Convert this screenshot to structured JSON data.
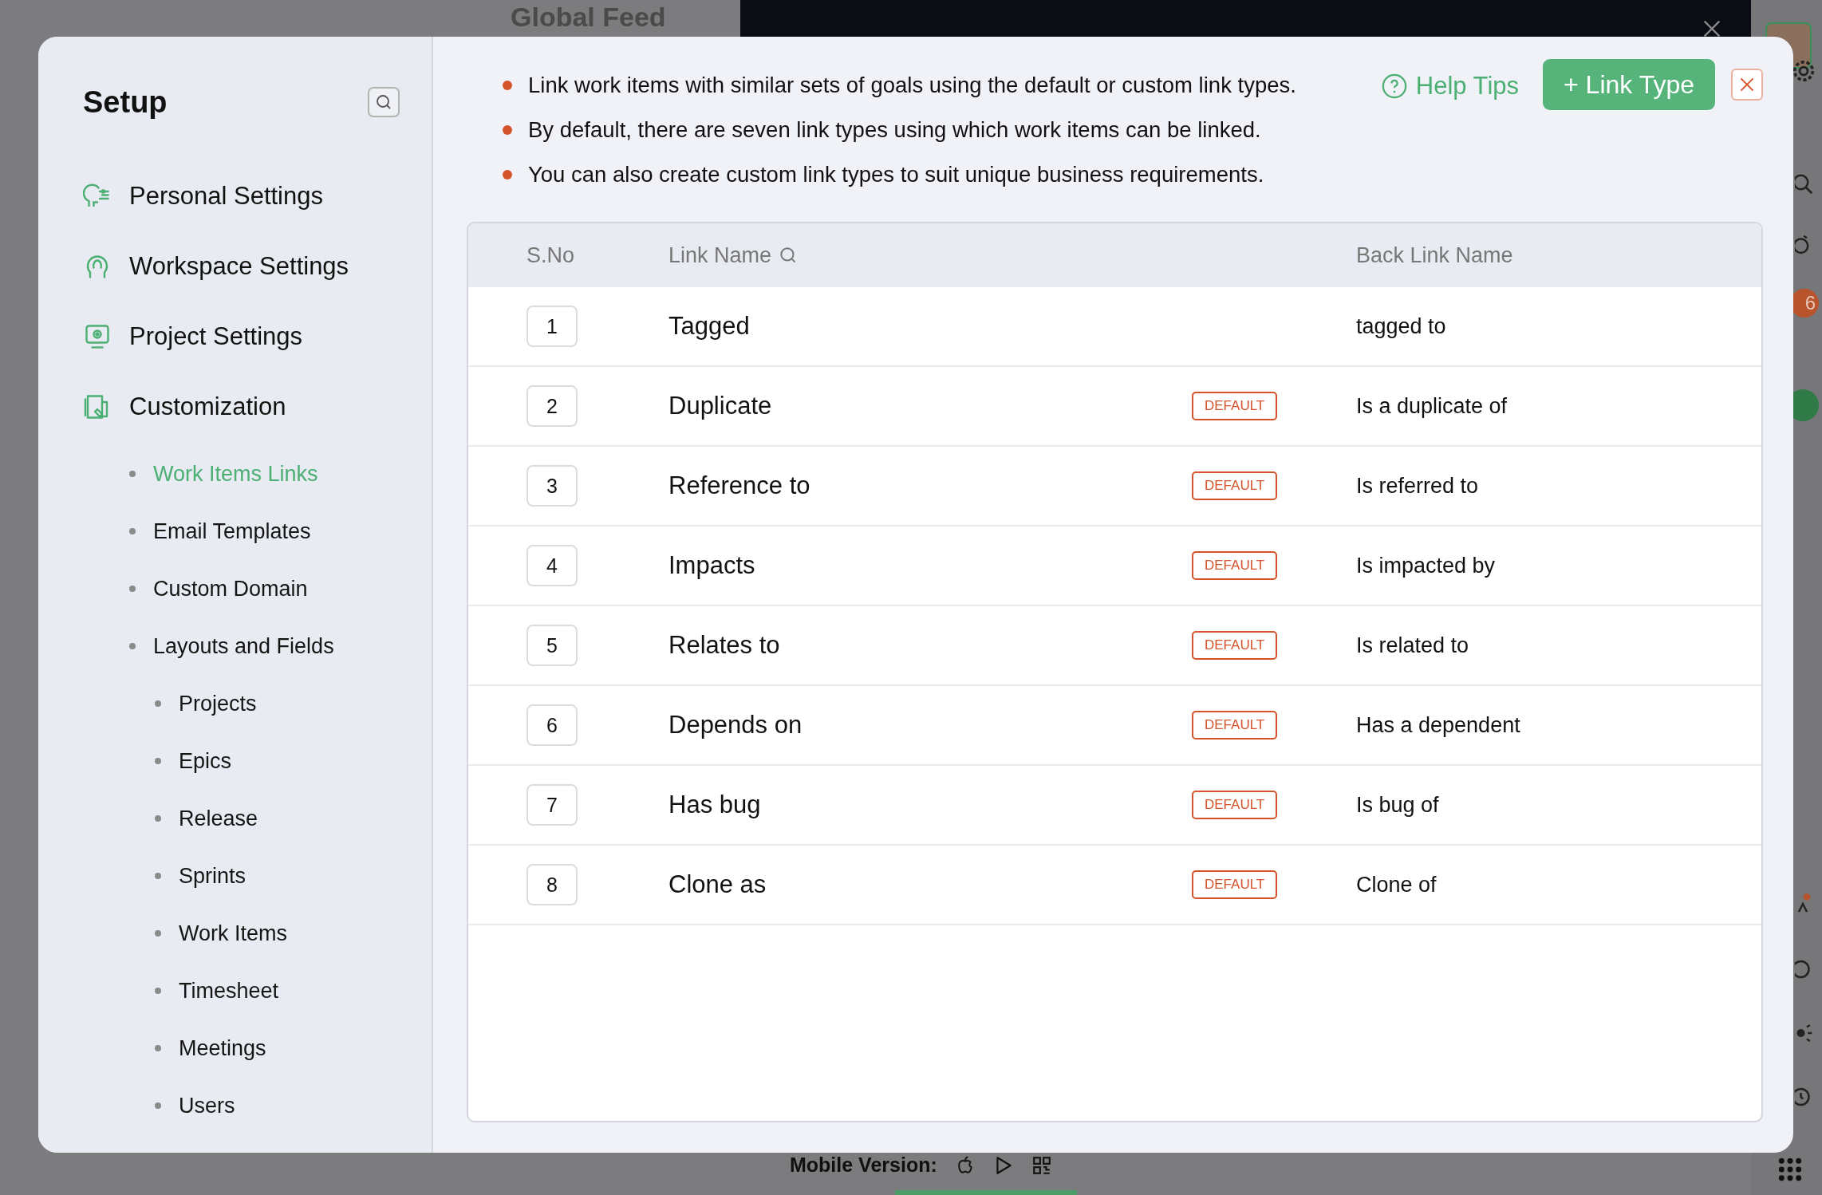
{
  "background": {
    "title": "Global Feed",
    "mobile_label": "Mobile Version:",
    "badge": "6"
  },
  "setup": {
    "title": "Setup",
    "nav": [
      {
        "label": "Personal Settings"
      },
      {
        "label": "Workspace Settings"
      },
      {
        "label": "Project Settings"
      },
      {
        "label": "Customization",
        "children": [
          {
            "label": "Work Items Links",
            "selected": true
          },
          {
            "label": "Email Templates",
            "selected": false
          },
          {
            "label": "Custom Domain",
            "selected": false
          },
          {
            "label": "Layouts and Fields",
            "selected": false,
            "children": [
              {
                "label": "Projects",
                "selected": false
              },
              {
                "label": "Epics",
                "selected": false
              },
              {
                "label": "Release",
                "selected": false
              },
              {
                "label": "Sprints",
                "selected": false
              },
              {
                "label": "Work Items",
                "selected": false
              },
              {
                "label": "Timesheet",
                "selected": false
              },
              {
                "label": "Meetings",
                "selected": false
              },
              {
                "label": "Users",
                "selected": false
              }
            ]
          }
        ]
      }
    ]
  },
  "tips": [
    "Link work items with similar sets of goals using the default or custom link types.",
    "By default, there are seven link types using which work items can be linked.",
    "You can also create custom link types to suit unique business requirements."
  ],
  "help_link": "Help Tips",
  "add_button": "+ Link Type",
  "table": {
    "columns": [
      "S.No",
      "Link Name",
      "Back Link Name"
    ],
    "rows": [
      {
        "sno": "1",
        "link_name": "Tagged",
        "back_link_name": "tagged to"
      },
      {
        "sno": "2",
        "link_name": "Duplicate",
        "tag": "DEFAULT",
        "back_link_name": "Is a duplicate of"
      },
      {
        "sno": "3",
        "link_name": "Reference to",
        "tag": "DEFAULT",
        "back_link_name": "Is referred to"
      },
      {
        "sno": "4",
        "link_name": "Impacts",
        "tag": "DEFAULT",
        "back_link_name": "Is impacted by"
      },
      {
        "sno": "5",
        "link_name": "Relates to",
        "tag": "DEFAULT",
        "back_link_name": "Is related to"
      },
      {
        "sno": "6",
        "link_name": "Depends on",
        "tag": "DEFAULT",
        "back_link_name": "Has a dependent"
      },
      {
        "sno": "7",
        "link_name": "Has bug",
        "tag": "DEFAULT",
        "back_link_name": "Is bug of"
      },
      {
        "sno": "8",
        "link_name": "Clone as",
        "tag": "DEFAULT",
        "back_link_name": "Clone of"
      }
    ]
  }
}
